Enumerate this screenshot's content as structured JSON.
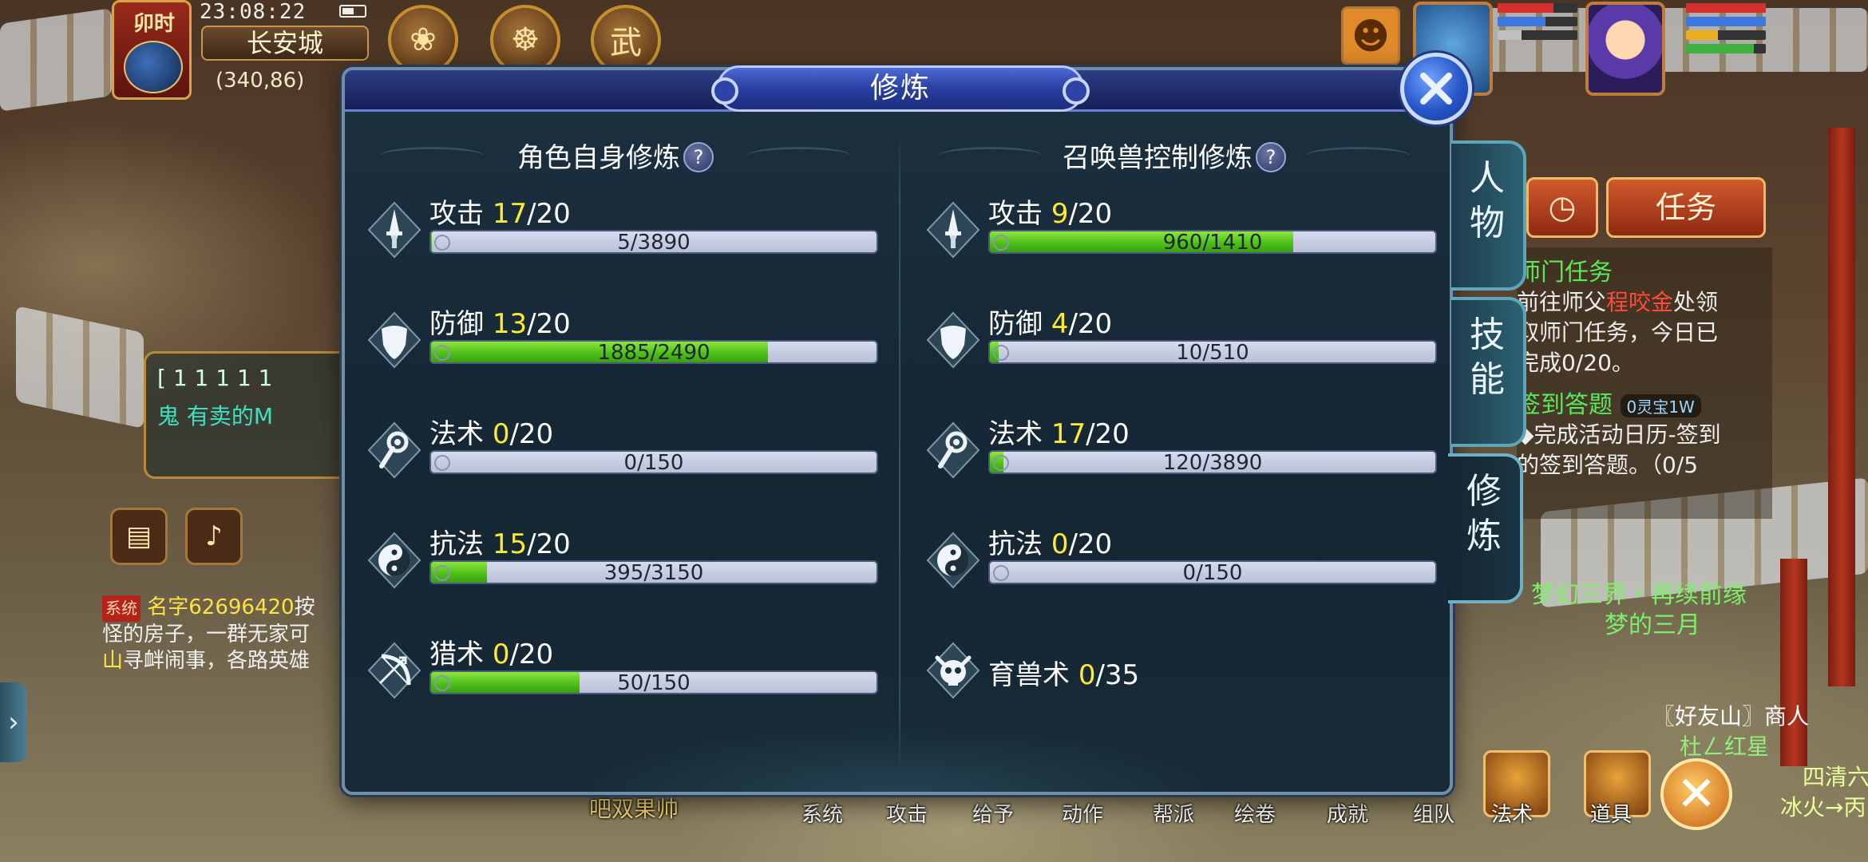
{
  "hud": {
    "shichen": "卯时",
    "clock": "23:08:22",
    "city": "长安城",
    "coords": "(340,86)"
  },
  "dialog": {
    "title": "修炼",
    "close_label": "close",
    "left": {
      "title": "角色自身修炼",
      "help": "?",
      "rows": [
        {
          "name": "攻击",
          "level": "17",
          "max": "/20",
          "progress": "5/3890",
          "fraction": 0.0013,
          "icon": "sword-icon"
        },
        {
          "name": "防御",
          "level": "13",
          "max": "/20",
          "progress": "1885/2490",
          "fraction": 0.757,
          "icon": "shield-icon"
        },
        {
          "name": "法术",
          "level": "0",
          "max": "/20",
          "progress": "0/150",
          "fraction": 0.0,
          "icon": "wand-icon"
        },
        {
          "name": "抗法",
          "level": "15",
          "max": "/20",
          "progress": "395/3150",
          "fraction": 0.125,
          "icon": "yinyang-icon"
        },
        {
          "name": "猎术",
          "level": "0",
          "max": "/20",
          "progress": "50/150",
          "fraction": 0.333,
          "icon": "bow-icon"
        }
      ]
    },
    "right": {
      "title": "召唤兽控制修炼",
      "help": "?",
      "rows": [
        {
          "name": "攻击",
          "level": "9",
          "max": "/20",
          "progress": "960/1410",
          "fraction": 0.681,
          "icon": "sword-icon"
        },
        {
          "name": "防御",
          "level": "4",
          "max": "/20",
          "progress": "10/510",
          "fraction": 0.0196,
          "icon": "shield-icon"
        },
        {
          "name": "法术",
          "level": "17",
          "max": "/20",
          "progress": "120/3890",
          "fraction": 0.031,
          "icon": "wand-icon"
        },
        {
          "name": "抗法",
          "level": "0",
          "max": "/20",
          "progress": "0/150",
          "fraction": 0.0,
          "icon": "yinyang-icon"
        },
        {
          "name": "育兽术",
          "level": "0",
          "max": "/35",
          "icon": "beast-skull-icon"
        }
      ]
    }
  },
  "side_tabs": [
    {
      "label_1": "人",
      "label_2": "物"
    },
    {
      "label_1": "技",
      "label_2": "能"
    },
    {
      "label_1": "修",
      "label_2": "炼"
    }
  ],
  "task": {
    "button": "任务",
    "title1": "师门任务",
    "body1a": "前往师父",
    "body1b": "程咬金",
    "body1c": "处领",
    "body1d": "取师门任务，今日已",
    "body1e": "完成0/20。",
    "title2": "签到答题",
    "gift": "0灵宝1W",
    "body2a": "◆完成活动日历-签到",
    "body2b": "的签到答题。（0/5",
    "banner1": "梦幻三界・再续前缘",
    "banner2": "梦的三月",
    "npc1": "〖好友山〗商人",
    "npc2": "杜ㄥ红星",
    "npc3": "四清六",
    "npc4": "冰火→丙"
  },
  "chat": {
    "line1": "[ 1 1 1 1 1",
    "line2": "鬼   有卖的M",
    "sys_tag": "系统",
    "sys_name": "名字62696420",
    "sys_tail": "按",
    "sys_line2": "怪的房子，一群无家可",
    "sys_line3a": "山",
    "sys_line3b": "寻衅闹事，各路英雄"
  },
  "bottom_bar": {
    "items": [
      "系统",
      "攻击",
      "给予",
      "动作",
      "帮派",
      "绘卷",
      "成就",
      "组队",
      "法术",
      "道具"
    ],
    "extra_text": "吧双果帅"
  }
}
